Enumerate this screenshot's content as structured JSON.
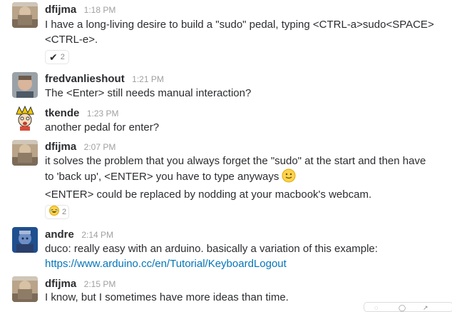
{
  "messages": [
    {
      "author": "dfijma",
      "time": "1:18 PM",
      "text": "I have a long-living desire to build a \"sudo\" pedal, typing <CTRL-a>sudo<SPACE><CTRL-e>.",
      "reaction": {
        "icon": "checkmark",
        "count": "2"
      }
    },
    {
      "author": "fredvanlieshout",
      "time": "1:21 PM",
      "text": "The <Enter> still needs manual interaction?"
    },
    {
      "author": "tkende",
      "time": "1:23 PM",
      "text": "another pedal for enter?"
    },
    {
      "author": "dfijma",
      "time": "2:07 PM",
      "text_line1": "it solves the problem that you always forget the \"sudo\" at the start and then have",
      "text_line2": "to 'back up', <ENTER> you have to type anyways",
      "text2": "<ENTER> could be replaced by nodding at your  macbook's webcam.",
      "reaction": {
        "icon": "laughing-face",
        "count": "2"
      }
    },
    {
      "author": "andre",
      "time": "2:14 PM",
      "text": "duco: really easy with an arduino. basically a variation of this example:",
      "link": "https://www.arduino.cc/en/Tutorial/KeyboardLogout"
    },
    {
      "author": "dfijma",
      "time": "2:15 PM",
      "text": "I know, but I sometimes have more ideas than time."
    }
  ],
  "colors": {
    "text": "#2c2d30",
    "timestamp": "#a0a0a2",
    "link": "#0576b9",
    "reaction_border": "#e6e6e6"
  }
}
